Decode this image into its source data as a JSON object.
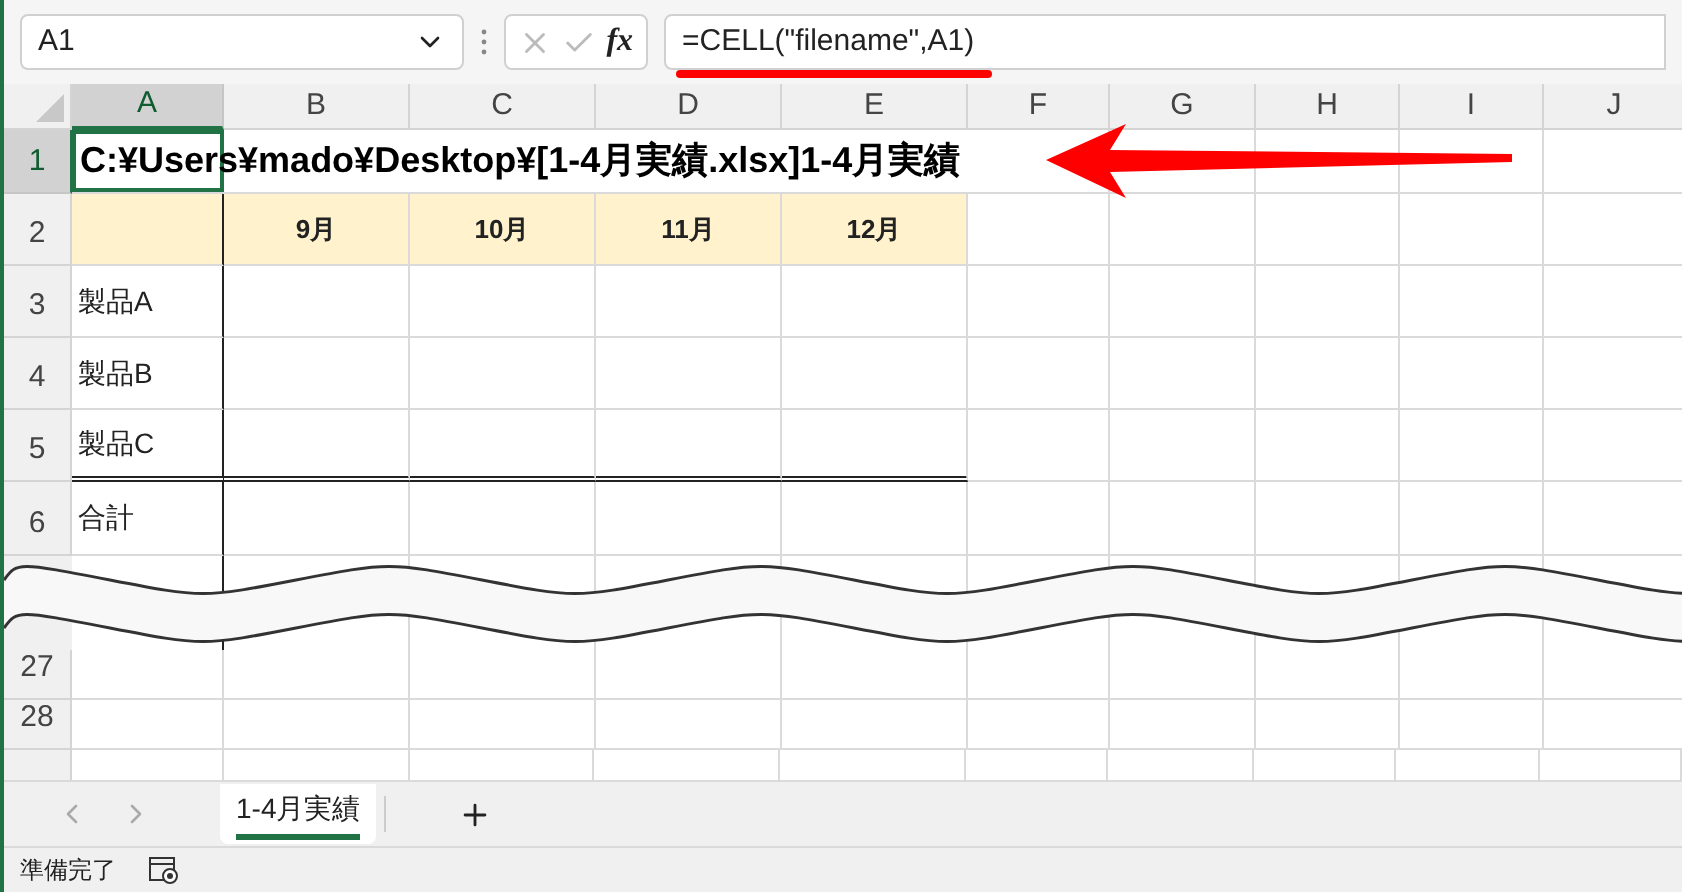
{
  "name_box": {
    "value": "A1"
  },
  "formula_bar": {
    "function_button": "fx",
    "formula": "=CELL(\"filename\",A1)"
  },
  "columns": [
    {
      "label": "A",
      "selected": true
    },
    {
      "label": "B",
      "selected": false
    },
    {
      "label": "C",
      "selected": false
    },
    {
      "label": "D",
      "selected": false
    },
    {
      "label": "E",
      "selected": false
    },
    {
      "label": "F",
      "selected": false
    },
    {
      "label": "G",
      "selected": false
    },
    {
      "label": "H",
      "selected": false
    },
    {
      "label": "I",
      "selected": false
    },
    {
      "label": "J",
      "selected": false
    }
  ],
  "rows": [
    {
      "label": "1",
      "selected": true,
      "kind": "title",
      "text": "C:¥Users¥mado¥Desktop¥[1-4月実績.xlsx]1-4月実績"
    },
    {
      "label": "2",
      "selected": false,
      "kind": "header",
      "cells": [
        "9月",
        "10月",
        "11月",
        "12月"
      ]
    },
    {
      "label": "3",
      "selected": false,
      "kind": "item",
      "text": "製品A"
    },
    {
      "label": "4",
      "selected": false,
      "kind": "item",
      "text": "製品B"
    },
    {
      "label": "5",
      "selected": false,
      "kind": "item",
      "text": "製品C"
    },
    {
      "label": "6",
      "selected": false,
      "kind": "total",
      "text": "合計"
    },
    {
      "label": "27",
      "selected": false,
      "kind": "empty"
    },
    {
      "label": "28",
      "selected": false,
      "kind": "empty"
    }
  ],
  "sheet_tabs": [
    {
      "label": "1-4月実績",
      "selected": true
    }
  ],
  "status_bar": {
    "text": "準備完了"
  }
}
